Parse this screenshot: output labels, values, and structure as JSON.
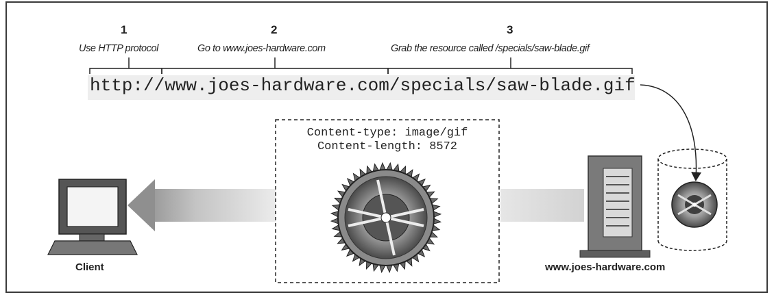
{
  "url_parts": [
    {
      "number": "1",
      "caption": "Use HTTP protocol",
      "text": "http://"
    },
    {
      "number": "2",
      "caption": "Go to www.joes-hardware.com",
      "text": "www.joes-hardware.com"
    },
    {
      "number": "3",
      "caption": "Grab the resource called /specials/saw-blade.gif",
      "text": "/specials/saw-blade.gif"
    }
  ],
  "response_headers": [
    "Content-type: image/gif",
    "Content-length: 8572"
  ],
  "client_label": "Client",
  "server_label": "www.joes-hardware.com",
  "icons": [
    "computer-monitor-icon",
    "server-icon",
    "database-cylinder-icon",
    "saw-blade-image"
  ],
  "colors": {
    "line": "#222222",
    "arrow_fill": "#c8c8c8",
    "url_highlight": "#eeeeee"
  }
}
